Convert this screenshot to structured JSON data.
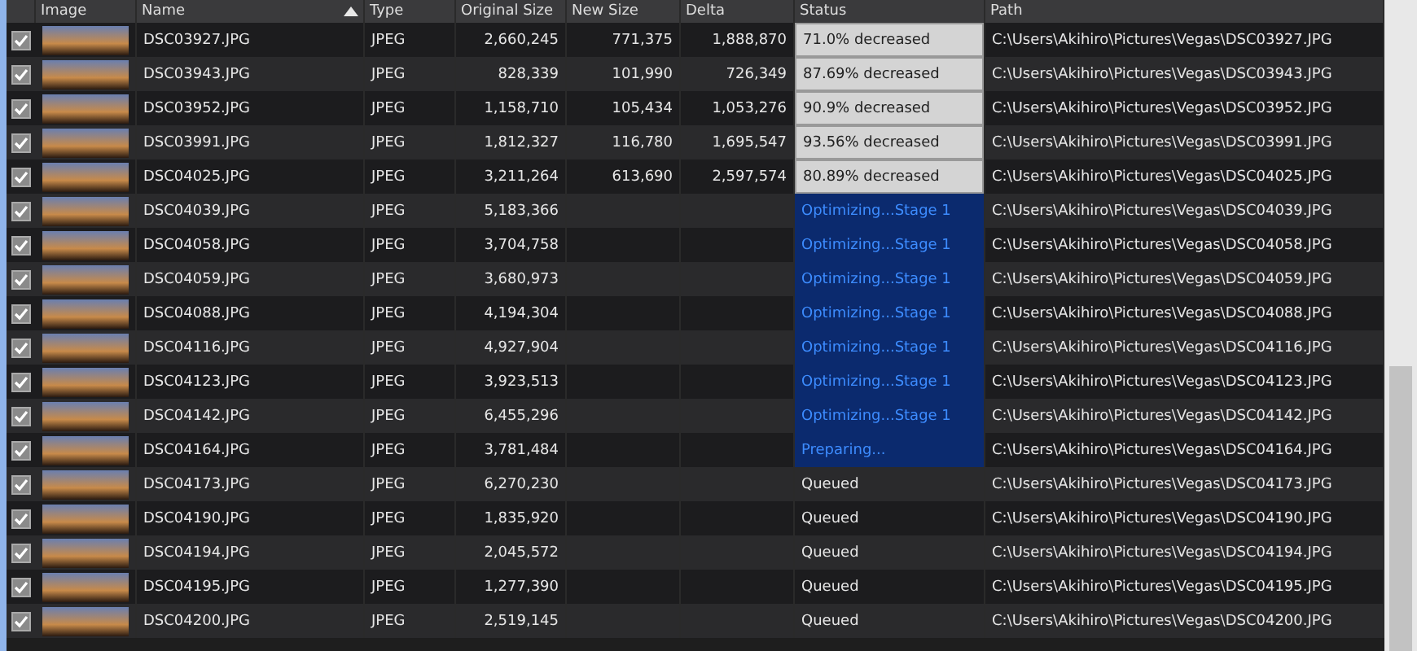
{
  "table": {
    "columns": [
      {
        "label": "Image",
        "sorted": false
      },
      {
        "label": "Name",
        "sorted": true
      },
      {
        "label": "Type",
        "sorted": false
      },
      {
        "label": "Original Size",
        "sorted": false
      },
      {
        "label": "New Size",
        "sorted": false
      },
      {
        "label": "Delta",
        "sorted": false
      },
      {
        "label": "Status",
        "sorted": false
      },
      {
        "label": "Path",
        "sorted": false
      }
    ],
    "rows": [
      {
        "checked": true,
        "name": "DSC03927.JPG",
        "type": "JPEG",
        "original_size": "2,660,245",
        "new_size": "771,375",
        "delta": "1,888,870",
        "status": {
          "text": "71.0% decreased",
          "kind": "done"
        },
        "path": "C:\\Users\\Akihiro\\Pictures\\Vegas\\DSC03927.JPG"
      },
      {
        "checked": true,
        "name": "DSC03943.JPG",
        "type": "JPEG",
        "original_size": "828,339",
        "new_size": "101,990",
        "delta": "726,349",
        "status": {
          "text": "87.69% decreased",
          "kind": "done"
        },
        "path": "C:\\Users\\Akihiro\\Pictures\\Vegas\\DSC03943.JPG"
      },
      {
        "checked": true,
        "name": "DSC03952.JPG",
        "type": "JPEG",
        "original_size": "1,158,710",
        "new_size": "105,434",
        "delta": "1,053,276",
        "status": {
          "text": "90.9% decreased",
          "kind": "done"
        },
        "path": "C:\\Users\\Akihiro\\Pictures\\Vegas\\DSC03952.JPG"
      },
      {
        "checked": true,
        "name": "DSC03991.JPG",
        "type": "JPEG",
        "original_size": "1,812,327",
        "new_size": "116,780",
        "delta": "1,695,547",
        "status": {
          "text": "93.56% decreased",
          "kind": "done"
        },
        "path": "C:\\Users\\Akihiro\\Pictures\\Vegas\\DSC03991.JPG"
      },
      {
        "checked": true,
        "name": "DSC04025.JPG",
        "type": "JPEG",
        "original_size": "3,211,264",
        "new_size": "613,690",
        "delta": "2,597,574",
        "status": {
          "text": "80.89% decreased",
          "kind": "done"
        },
        "path": "C:\\Users\\Akihiro\\Pictures\\Vegas\\DSC04025.JPG"
      },
      {
        "checked": true,
        "name": "DSC04039.JPG",
        "type": "JPEG",
        "original_size": "5,183,366",
        "status": {
          "text": "Optimizing...Stage 1",
          "kind": "active"
        },
        "path": "C:\\Users\\Akihiro\\Pictures\\Vegas\\DSC04039.JPG"
      },
      {
        "checked": true,
        "name": "DSC04058.JPG",
        "type": "JPEG",
        "original_size": "3,704,758",
        "status": {
          "text": "Optimizing...Stage 1",
          "kind": "active"
        },
        "path": "C:\\Users\\Akihiro\\Pictures\\Vegas\\DSC04058.JPG"
      },
      {
        "checked": true,
        "name": "DSC04059.JPG",
        "type": "JPEG",
        "original_size": "3,680,973",
        "status": {
          "text": "Optimizing...Stage 1",
          "kind": "active"
        },
        "path": "C:\\Users\\Akihiro\\Pictures\\Vegas\\DSC04059.JPG"
      },
      {
        "checked": true,
        "name": "DSC04088.JPG",
        "type": "JPEG",
        "original_size": "4,194,304",
        "status": {
          "text": "Optimizing...Stage 1",
          "kind": "active"
        },
        "path": "C:\\Users\\Akihiro\\Pictures\\Vegas\\DSC04088.JPG"
      },
      {
        "checked": true,
        "name": "DSC04116.JPG",
        "type": "JPEG",
        "original_size": "4,927,904",
        "status": {
          "text": "Optimizing...Stage 1",
          "kind": "active"
        },
        "path": "C:\\Users\\Akihiro\\Pictures\\Vegas\\DSC04116.JPG"
      },
      {
        "checked": true,
        "name": "DSC04123.JPG",
        "type": "JPEG",
        "original_size": "3,923,513",
        "status": {
          "text": "Optimizing...Stage 1",
          "kind": "active"
        },
        "path": "C:\\Users\\Akihiro\\Pictures\\Vegas\\DSC04123.JPG"
      },
      {
        "checked": true,
        "name": "DSC04142.JPG",
        "type": "JPEG",
        "original_size": "6,455,296",
        "status": {
          "text": "Optimizing...Stage 1",
          "kind": "active"
        },
        "path": "C:\\Users\\Akihiro\\Pictures\\Vegas\\DSC04142.JPG"
      },
      {
        "checked": true,
        "name": "DSC04164.JPG",
        "type": "JPEG",
        "original_size": "3,781,484",
        "status": {
          "text": "Preparing...",
          "kind": "active"
        },
        "path": "C:\\Users\\Akihiro\\Pictures\\Vegas\\DSC04164.JPG"
      },
      {
        "checked": true,
        "name": "DSC04173.JPG",
        "type": "JPEG",
        "original_size": "6,270,230",
        "status": {
          "text": "Queued",
          "kind": "queued"
        },
        "path": "C:\\Users\\Akihiro\\Pictures\\Vegas\\DSC04173.JPG"
      },
      {
        "checked": true,
        "name": "DSC04190.JPG",
        "type": "JPEG",
        "original_size": "1,835,920",
        "status": {
          "text": "Queued",
          "kind": "queued"
        },
        "path": "C:\\Users\\Akihiro\\Pictures\\Vegas\\DSC04190.JPG"
      },
      {
        "checked": true,
        "name": "DSC04194.JPG",
        "type": "JPEG",
        "original_size": "2,045,572",
        "status": {
          "text": "Queued",
          "kind": "queued"
        },
        "path": "C:\\Users\\Akihiro\\Pictures\\Vegas\\DSC04194.JPG"
      },
      {
        "checked": true,
        "name": "DSC04195.JPG",
        "type": "JPEG",
        "original_size": "1,277,390",
        "status": {
          "text": "Queued",
          "kind": "queued"
        },
        "path": "C:\\Users\\Akihiro\\Pictures\\Vegas\\DSC04195.JPG"
      },
      {
        "checked": true,
        "name": "DSC04200.JPG",
        "type": "JPEG",
        "original_size": "2,519,145",
        "status": {
          "text": "Queued",
          "kind": "queued"
        },
        "path": "C:\\Users\\Akihiro\\Pictures\\Vegas\\DSC04200.JPG"
      }
    ]
  }
}
